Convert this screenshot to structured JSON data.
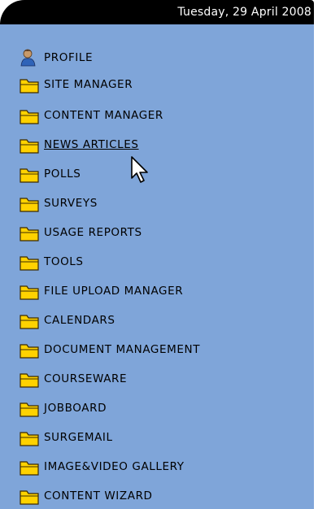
{
  "header": {
    "date": "Tuesday, 29 April 2008"
  },
  "colors": {
    "panel_bg": "#7fa5d9",
    "header_bg": "#000000",
    "folder_fill": "#ffd200",
    "folder_outline": "#3a2a00"
  },
  "menu": {
    "items": [
      {
        "label": "PROFILE",
        "icon": "user-profile-icon"
      },
      {
        "label": "SITE MANAGER",
        "icon": "folder-icon"
      },
      {
        "label": "CONTENT MANAGER",
        "icon": "folder-icon"
      },
      {
        "label": "NEWS ARTICLES",
        "icon": "folder-icon",
        "state": "hovered"
      },
      {
        "label": "POLLS",
        "icon": "folder-icon"
      },
      {
        "label": "SURVEYS",
        "icon": "folder-icon"
      },
      {
        "label": "USAGE REPORTS",
        "icon": "folder-icon"
      },
      {
        "label": "TOOLS",
        "icon": "folder-icon"
      },
      {
        "label": "FILE UPLOAD MANAGER",
        "icon": "folder-icon"
      },
      {
        "label": "CALENDARS",
        "icon": "folder-icon"
      },
      {
        "label": "DOCUMENT MANAGEMENT",
        "icon": "folder-icon"
      },
      {
        "label": "COURSEWARE",
        "icon": "folder-icon"
      },
      {
        "label": "JOBBOARD",
        "icon": "folder-icon"
      },
      {
        "label": "SURGEMAIL",
        "icon": "folder-icon"
      },
      {
        "label": "IMAGE&VIDEO GALLERY",
        "icon": "folder-icon"
      },
      {
        "label": "CONTENT WIZARD",
        "icon": "folder-icon"
      }
    ]
  },
  "cursor": {
    "icon": "mouse-pointer-icon"
  }
}
